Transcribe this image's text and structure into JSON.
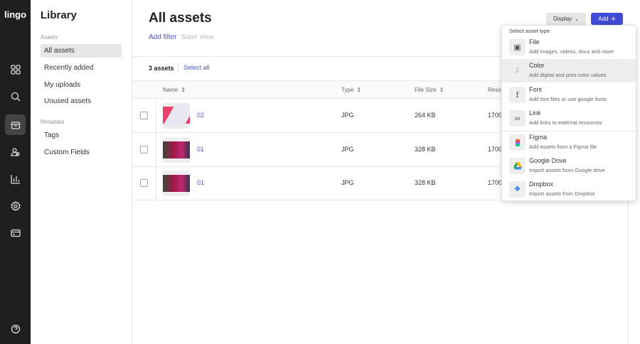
{
  "app": {
    "logo": "lingo"
  },
  "library": {
    "title": "Library",
    "sections": [
      {
        "label": "Assets",
        "items": [
          "All assets",
          "Recently added",
          "My uploads",
          "Unused assets"
        ]
      },
      {
        "label": "Metadata",
        "items": [
          "Tags",
          "Custom Fields"
        ]
      }
    ]
  },
  "header": {
    "title": "All assets",
    "add_filter": "Add filter",
    "save_view": "Save view",
    "display": "Display",
    "add": "Add"
  },
  "toolbar": {
    "count": "3 assets",
    "select_all": "Select all"
  },
  "table": {
    "columns": [
      "Name",
      "Type",
      "File Size",
      "Resol"
    ],
    "rows": [
      {
        "name": "02",
        "type": "JPG",
        "size": "264 KB",
        "res": "1700"
      },
      {
        "name": "01",
        "type": "JPG",
        "size": "328 KB",
        "res": "1700"
      },
      {
        "name": "01",
        "type": "JPG",
        "size": "328 KB",
        "res": "1700"
      }
    ]
  },
  "dropdown": {
    "heading": "Select asset type",
    "options": [
      {
        "title": "File",
        "desc": "Add images, videos, docs and more",
        "icon": "image-icon"
      },
      {
        "title": "Color",
        "desc": "Add digital and print color values",
        "icon": "droplet-icon"
      },
      {
        "title": "Font",
        "desc": "Add font files or use google fonts",
        "icon": "font-icon"
      },
      {
        "title": "Link",
        "desc": "Add links to external resources",
        "icon": "link-icon"
      },
      {
        "title": "Figma",
        "desc": "Add assets from a Figma file",
        "icon": "figma-icon"
      },
      {
        "title": "Google Drive",
        "desc": "Import assets from Google drive",
        "icon": "google-drive-icon"
      },
      {
        "title": "Dropbox",
        "desc": "Import assets from Dropbox",
        "icon": "dropbox-icon"
      }
    ]
  },
  "colors": {
    "accent": "#3f4ad6",
    "rail": "#1f1f1f"
  }
}
